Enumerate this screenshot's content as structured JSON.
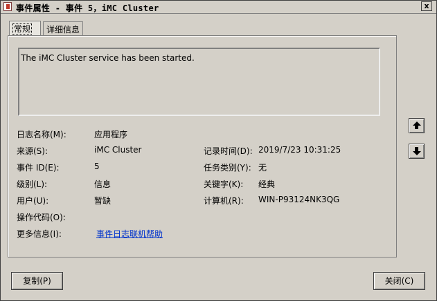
{
  "window": {
    "title": "事件属性 - 事件 5，iMC Cluster",
    "close_label": "x"
  },
  "tabs": [
    {
      "label": "常规"
    },
    {
      "label": "详细信息"
    }
  ],
  "description": "The iMC Cluster service has been started.",
  "fields": {
    "log_name": {
      "label": "日志名称(M):",
      "value": "应用程序"
    },
    "source": {
      "label": "来源(S):",
      "value": "iMC Cluster"
    },
    "logged": {
      "label": "记录时间(D):",
      "value": "2019/7/23 10:31:25"
    },
    "event_id": {
      "label": "事件 ID(E):",
      "value": "5"
    },
    "task_category": {
      "label": "任务类别(Y):",
      "value": "无"
    },
    "level": {
      "label": "级别(L):",
      "value": "信息"
    },
    "keywords": {
      "label": "关键字(K):",
      "value": "经典"
    },
    "user": {
      "label": "用户(U):",
      "value": "暂缺"
    },
    "computer": {
      "label": "计算机(R):",
      "value": "WIN-P93124NK3QG"
    },
    "opcode": {
      "label": "操作代码(O):",
      "value": ""
    },
    "more_info": {
      "label": "更多信息(I):",
      "value": "事件日志联机帮助"
    }
  },
  "buttons": {
    "copy": "复制(P)",
    "close": "关闭(C)"
  },
  "icons": {
    "up": "arrow-up-icon",
    "down": "arrow-down-icon"
  }
}
